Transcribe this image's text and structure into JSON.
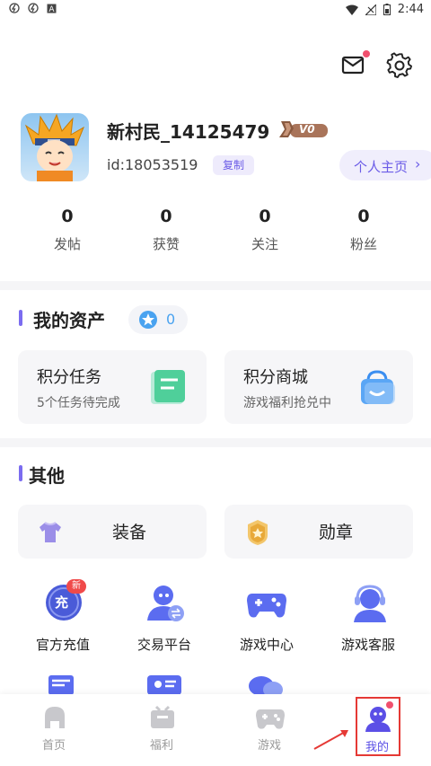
{
  "status": {
    "time": "2:44"
  },
  "header": {
    "mail_icon": "mail-icon",
    "settings_icon": "gear-icon"
  },
  "profile": {
    "name": "新村民_14125479",
    "vip_badge": "V0",
    "id_text": "id:18053519",
    "copy_label": "复制",
    "homepage_label": "个人主页"
  },
  "stats": [
    {
      "value": "0",
      "label": "发帖"
    },
    {
      "value": "0",
      "label": "获赞"
    },
    {
      "value": "0",
      "label": "关注"
    },
    {
      "value": "0",
      "label": "粉丝"
    }
  ],
  "assets": {
    "title": "我的资产",
    "points": "0",
    "cards": [
      {
        "title": "积分任务",
        "sub": "5个任务待完成"
      },
      {
        "title": "积分商城",
        "sub": "游戏福利抢兑中"
      }
    ]
  },
  "other": {
    "title": "其他",
    "buttons": [
      {
        "label": "装备"
      },
      {
        "label": "勋章"
      }
    ],
    "grid": [
      {
        "label": "官方充值",
        "badge": "新",
        "icon_text": "充"
      },
      {
        "label": "交易平台"
      },
      {
        "label": "游戏中心"
      },
      {
        "label": "游戏客服"
      }
    ]
  },
  "tabs": [
    {
      "label": "首页"
    },
    {
      "label": "福利"
    },
    {
      "label": "游戏"
    },
    {
      "label": "我的"
    }
  ],
  "colors": {
    "accent": "#7b6cf0",
    "active_tab": "#5b4fe6",
    "highlight_box": "#e53935"
  }
}
